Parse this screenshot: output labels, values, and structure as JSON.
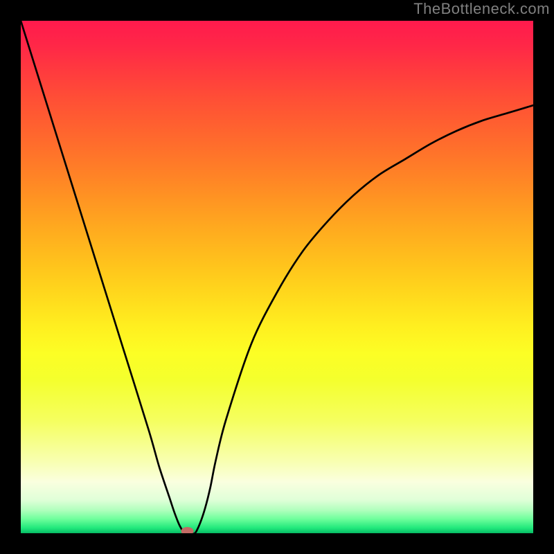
{
  "watermark": "TheBottleneck.com",
  "chart_data": {
    "type": "line",
    "title": "",
    "xlabel": "",
    "ylabel": "",
    "xlim": [
      0,
      100
    ],
    "ylim": [
      0,
      100
    ],
    "x": [
      0,
      5,
      10,
      15,
      20,
      25,
      27,
      29,
      30,
      31,
      32,
      33,
      34,
      35,
      36,
      37,
      38,
      40,
      45,
      50,
      55,
      60,
      65,
      70,
      75,
      80,
      85,
      90,
      95,
      100
    ],
    "values": [
      100,
      84,
      68,
      52,
      36,
      20,
      13,
      7,
      4,
      1.5,
      0,
      0,
      0,
      2,
      5,
      9,
      14,
      22,
      37,
      47,
      55,
      61,
      66,
      70,
      73,
      76,
      78.5,
      80.5,
      82,
      83.5
    ],
    "marker": {
      "x": 32.5,
      "y": 0,
      "rx": 9,
      "ry": 6,
      "color": "#c36b65"
    },
    "gradient_bands": [
      {
        "y": 0.0,
        "color": "#ff1a4d"
      },
      {
        "y": 0.05,
        "color": "#ff2847"
      },
      {
        "y": 0.1,
        "color": "#ff3b3e"
      },
      {
        "y": 0.15,
        "color": "#ff4e36"
      },
      {
        "y": 0.2,
        "color": "#ff5f30"
      },
      {
        "y": 0.25,
        "color": "#ff702b"
      },
      {
        "y": 0.3,
        "color": "#ff8226"
      },
      {
        "y": 0.35,
        "color": "#ff9522"
      },
      {
        "y": 0.4,
        "color": "#ffa81f"
      },
      {
        "y": 0.45,
        "color": "#ffba1d"
      },
      {
        "y": 0.5,
        "color": "#ffcc1c"
      },
      {
        "y": 0.55,
        "color": "#ffde1d"
      },
      {
        "y": 0.6,
        "color": "#fff020"
      },
      {
        "y": 0.65,
        "color": "#fcfe25"
      },
      {
        "y": 0.7,
        "color": "#f4ff2d"
      },
      {
        "y": 0.78,
        "color": "#f5ff5f"
      },
      {
        "y": 0.86,
        "color": "#f8ffb1"
      },
      {
        "y": 0.9,
        "color": "#faffdf"
      },
      {
        "y": 0.935,
        "color": "#e0ffd8"
      },
      {
        "y": 0.955,
        "color": "#b0ffbd"
      },
      {
        "y": 0.972,
        "color": "#6fff9c"
      },
      {
        "y": 0.99,
        "color": "#20e87b"
      },
      {
        "y": 0.997,
        "color": "#0dc96c"
      },
      {
        "y": 1.0,
        "color": "#08b862"
      }
    ]
  }
}
